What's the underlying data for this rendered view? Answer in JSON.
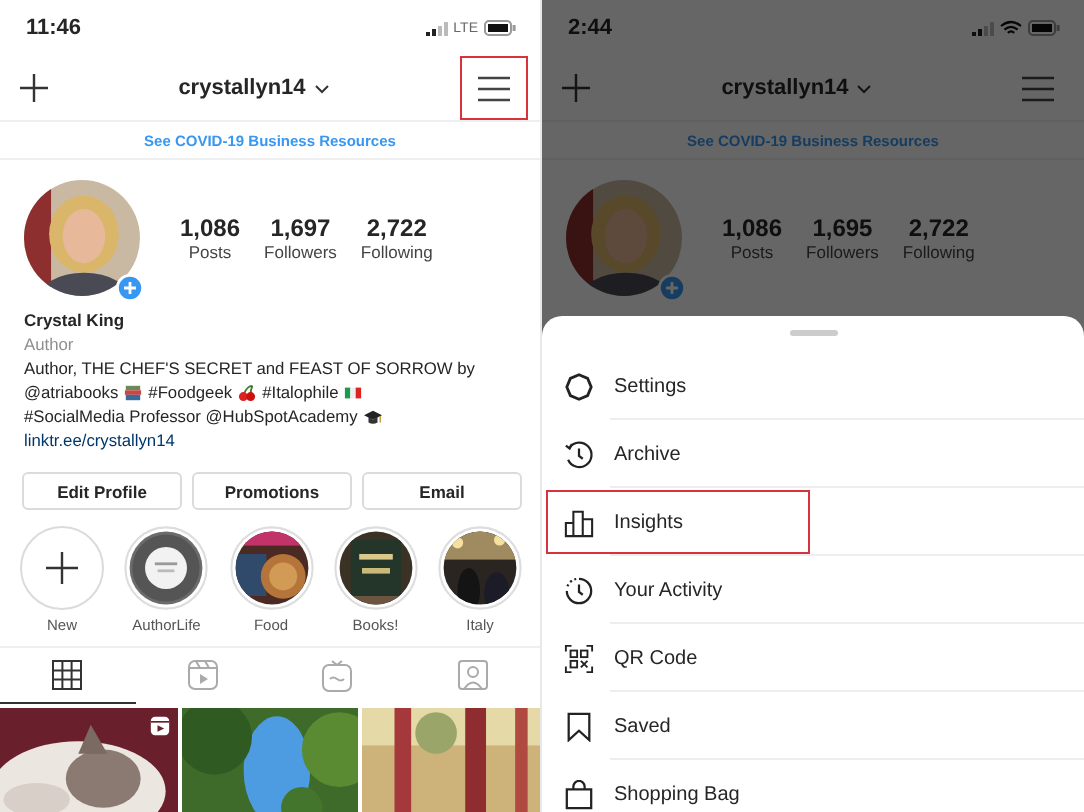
{
  "profile_screen": {
    "status_bar": {
      "time": "11:46",
      "network": "LTE"
    },
    "nav": {
      "username": "crystallyn14",
      "menu_highlighted": true
    },
    "banner": "See COVID-19 Business Resources",
    "stats": [
      {
        "value": "1,086",
        "label": "Posts"
      },
      {
        "value": "1,697",
        "label": "Followers"
      },
      {
        "value": "2,722",
        "label": "Following"
      }
    ],
    "name": "Crystal King",
    "category": "Author",
    "bio_lines": [
      [
        {
          "kind": "text",
          "text": "Author, THE CHEF'S SECRET and FEAST OF SORROW by"
        }
      ],
      [
        {
          "kind": "text",
          "text": "@atriabooks"
        },
        {
          "kind": "books"
        },
        {
          "kind": "text",
          "text": "#Foodgeek"
        },
        {
          "kind": "cherries"
        },
        {
          "kind": "text",
          "text": "#Italophile"
        },
        {
          "kind": "flag"
        }
      ],
      [
        {
          "kind": "text",
          "text": "#SocialMedia Professor @HubSpotAcademy"
        },
        {
          "kind": "cap"
        }
      ]
    ],
    "link": "linktr.ee/crystallyn14",
    "buttons": [
      "Edit Profile",
      "Promotions",
      "Email"
    ],
    "highlights": [
      {
        "label": "New",
        "kind": "new"
      },
      {
        "label": "AuthorLife",
        "kind": "picture"
      },
      {
        "label": "Food",
        "kind": "picture"
      },
      {
        "label": "Books!",
        "kind": "picture"
      },
      {
        "label": "Italy",
        "kind": "picture"
      }
    ],
    "tabs": [
      {
        "kind": "grid",
        "selected": true
      },
      {
        "kind": "reels",
        "selected": false
      },
      {
        "kind": "igtv",
        "selected": false
      },
      {
        "kind": "tagged",
        "selected": false
      }
    ],
    "posts": [
      {
        "kind": "picture",
        "reel": true
      },
      {
        "kind": "picture",
        "reel": false
      },
      {
        "kind": "picture",
        "reel": false
      }
    ]
  },
  "menu_screen": {
    "status_bar": {
      "time": "2:44"
    },
    "nav": {
      "username": "crystallyn14"
    },
    "banner": "See COVID-19 Business Resources",
    "stats": [
      {
        "value": "1,086",
        "label": "Posts"
      },
      {
        "value": "1,695",
        "label": "Followers"
      },
      {
        "value": "2,722",
        "label": "Following"
      }
    ],
    "menu": [
      {
        "label": "Settings",
        "kind": "settings",
        "highlighted": false
      },
      {
        "label": "Archive",
        "kind": "archive",
        "highlighted": false
      },
      {
        "label": "Insights",
        "kind": "insights",
        "highlighted": true
      },
      {
        "label": "Your Activity",
        "kind": "activity",
        "highlighted": false
      },
      {
        "label": "QR Code",
        "kind": "qr",
        "highlighted": false
      },
      {
        "label": "Saved",
        "kind": "saved",
        "highlighted": false
      },
      {
        "label": "Shopping Bag",
        "kind": "bag",
        "highlighted": false
      }
    ]
  }
}
